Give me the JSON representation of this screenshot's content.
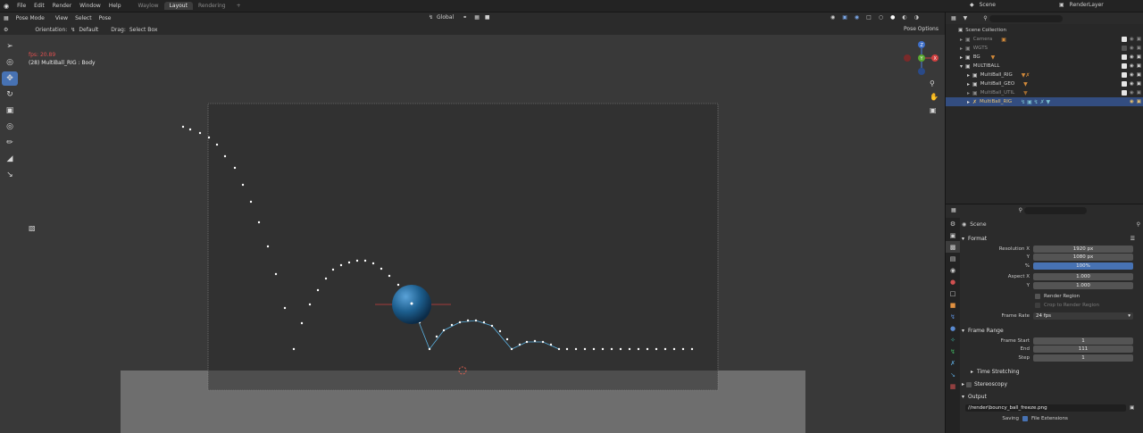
{
  "topbar": {
    "menus": [
      "File",
      "Edit",
      "Render",
      "Window",
      "Help"
    ],
    "workspaces": [
      {
        "label": "Waylow",
        "active": false
      },
      {
        "label": "Layout",
        "active": true
      },
      {
        "label": "Rendering",
        "active": false
      }
    ],
    "add_tab": "+",
    "scene_name": "Scene",
    "view_layer": "RenderLayer"
  },
  "viewport": {
    "mode": "Pose Mode",
    "menus": [
      "View",
      "Select",
      "Pose"
    ],
    "transform_orientation": "Global",
    "orientation_label": "Orientation:",
    "orientation_value": "Default",
    "drag_label": "Drag:",
    "drag_value": "Select Box",
    "pose_options": "Pose Options",
    "fps": "fps: 20.89",
    "object_info": "(28) MultiBall_RIG : Body",
    "axis_labels": {
      "y": "Y",
      "x": "X",
      "z": "Z"
    },
    "colors": {
      "background": "#393939",
      "camera_frame": "#2e2e2e",
      "floor": "#6e6e6e",
      "motion_path": "#ffffff",
      "ball": "#1d5f8f",
      "accent": "#4772b3"
    }
  },
  "motion_path_points": [
    [
      205,
      142
    ],
    [
      213,
      145
    ],
    [
      224,
      149
    ],
    [
      234,
      154
    ],
    [
      243,
      162
    ],
    [
      252,
      175
    ],
    [
      263,
      188
    ],
    [
      272,
      207
    ],
    [
      281,
      226
    ],
    [
      290,
      249
    ],
    [
      300,
      276
    ],
    [
      309,
      307
    ],
    [
      319,
      345
    ],
    [
      329,
      391
    ],
    [
      338,
      362
    ],
    [
      347,
      341
    ],
    [
      356,
      325
    ],
    [
      365,
      312
    ],
    [
      373,
      302
    ],
    [
      382,
      297
    ],
    [
      391,
      294
    ],
    [
      400,
      292
    ],
    [
      409,
      292
    ],
    [
      418,
      295
    ],
    [
      427,
      301
    ],
    [
      436,
      309
    ],
    [
      446,
      319
    ],
    [
      458,
      338
    ],
    [
      470,
      361
    ],
    [
      481,
      391
    ],
    [
      489,
      377
    ],
    [
      497,
      370
    ],
    [
      506,
      364
    ],
    [
      515,
      361
    ],
    [
      524,
      359
    ],
    [
      533,
      359
    ],
    [
      542,
      361
    ],
    [
      551,
      365
    ],
    [
      560,
      371
    ],
    [
      568,
      380
    ],
    [
      573,
      391
    ],
    [
      582,
      386
    ],
    [
      590,
      383
    ],
    [
      599,
      382
    ],
    [
      608,
      383
    ],
    [
      617,
      386
    ],
    [
      626,
      391
    ],
    [
      635,
      391
    ],
    [
      645,
      391
    ],
    [
      655,
      391
    ],
    [
      665,
      391
    ],
    [
      675,
      391
    ],
    [
      685,
      391
    ],
    [
      695,
      391
    ],
    [
      705,
      391
    ],
    [
      715,
      391
    ],
    [
      725,
      391
    ],
    [
      735,
      391
    ],
    [
      745,
      391
    ],
    [
      755,
      391
    ],
    [
      765,
      391
    ],
    [
      775,
      391
    ]
  ],
  "outliner": {
    "search_placeholder": "",
    "collection_root": "Scene Collection",
    "rows": [
      {
        "name": "Camera",
        "indent": 1,
        "dim": true,
        "icon": "camera-icon"
      },
      {
        "name": "WGTS",
        "indent": 1,
        "dim": true,
        "icon": "collection-icon"
      },
      {
        "name": "BG",
        "indent": 1,
        "dim": false,
        "icon": "collection-icon"
      },
      {
        "name": "MULTIBALL",
        "indent": 1,
        "dim": false,
        "icon": "collection-icon"
      },
      {
        "name": "MultiBall_RIG",
        "indent": 2,
        "dim": false,
        "icon": "collection-icon"
      },
      {
        "name": "MultiBall_GEO",
        "indent": 2,
        "dim": false,
        "icon": "collection-icon"
      },
      {
        "name": "MultiBall_UTIL",
        "indent": 2,
        "dim": true,
        "icon": "collection-icon"
      },
      {
        "name": "MultiBall_RIG",
        "indent": 2,
        "dim": false,
        "selected": true,
        "icon": "armature-icon"
      }
    ]
  },
  "properties": {
    "search_placeholder": "",
    "context": "Scene",
    "format": {
      "title": "Format",
      "resolution_x_label": "Resolution X",
      "resolution_x": "1920 px",
      "y_label": "Y",
      "resolution_y": "1080 px",
      "percent_label": "%",
      "percent": "100%",
      "aspect_x_label": "Aspect X",
      "aspect_x": "1.000",
      "aspect_y_label": "Y",
      "aspect_y": "1.000",
      "render_region": "Render Region",
      "crop_region": "Crop to Render Region",
      "frame_rate_label": "Frame Rate",
      "frame_rate": "24 fps"
    },
    "frame_range": {
      "title": "Frame Range",
      "start_label": "Frame Start",
      "start": "1",
      "end_label": "End",
      "end": "111",
      "step_label": "Step",
      "step": "1"
    },
    "time_stretching": "Time Stretching",
    "stereoscopy": "Stereoscopy",
    "output": {
      "title": "Output",
      "path": "//render\\bouncy_ball_freeze.png",
      "saving_label": "Saving",
      "file_extensions": "File Extensions"
    }
  }
}
